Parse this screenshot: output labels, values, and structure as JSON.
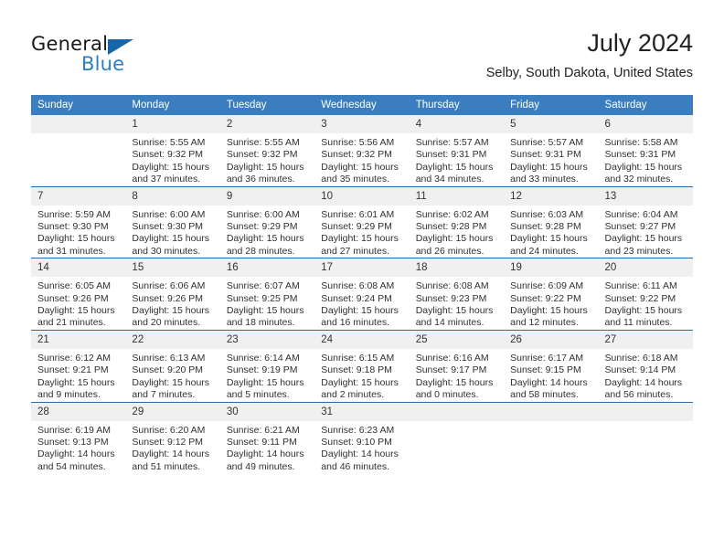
{
  "brand": {
    "name_part1": "General",
    "name_part2": "Blue",
    "accent_color": "#2a7fc9",
    "triangle_color": "#1565a8"
  },
  "header": {
    "title": "July 2024",
    "subtitle": "Selby, South Dakota, United States"
  },
  "theme": {
    "header_bg": "#3a7ebf",
    "row_divider": "#2a6ca8",
    "daynum_bg": "#f0f0f0"
  },
  "weekday_headers": [
    "Sunday",
    "Monday",
    "Tuesday",
    "Wednesday",
    "Thursday",
    "Friday",
    "Saturday"
  ],
  "weeks": [
    [
      {
        "day": "",
        "sunrise": "",
        "sunset": "",
        "daylight_line1": "",
        "daylight_line2": ""
      },
      {
        "day": "1",
        "sunrise": "Sunrise: 5:55 AM",
        "sunset": "Sunset: 9:32 PM",
        "daylight_line1": "Daylight: 15 hours",
        "daylight_line2": "and 37 minutes."
      },
      {
        "day": "2",
        "sunrise": "Sunrise: 5:55 AM",
        "sunset": "Sunset: 9:32 PM",
        "daylight_line1": "Daylight: 15 hours",
        "daylight_line2": "and 36 minutes."
      },
      {
        "day": "3",
        "sunrise": "Sunrise: 5:56 AM",
        "sunset": "Sunset: 9:32 PM",
        "daylight_line1": "Daylight: 15 hours",
        "daylight_line2": "and 35 minutes."
      },
      {
        "day": "4",
        "sunrise": "Sunrise: 5:57 AM",
        "sunset": "Sunset: 9:31 PM",
        "daylight_line1": "Daylight: 15 hours",
        "daylight_line2": "and 34 minutes."
      },
      {
        "day": "5",
        "sunrise": "Sunrise: 5:57 AM",
        "sunset": "Sunset: 9:31 PM",
        "daylight_line1": "Daylight: 15 hours",
        "daylight_line2": "and 33 minutes."
      },
      {
        "day": "6",
        "sunrise": "Sunrise: 5:58 AM",
        "sunset": "Sunset: 9:31 PM",
        "daylight_line1": "Daylight: 15 hours",
        "daylight_line2": "and 32 minutes."
      }
    ],
    [
      {
        "day": "7",
        "sunrise": "Sunrise: 5:59 AM",
        "sunset": "Sunset: 9:30 PM",
        "daylight_line1": "Daylight: 15 hours",
        "daylight_line2": "and 31 minutes."
      },
      {
        "day": "8",
        "sunrise": "Sunrise: 6:00 AM",
        "sunset": "Sunset: 9:30 PM",
        "daylight_line1": "Daylight: 15 hours",
        "daylight_line2": "and 30 minutes."
      },
      {
        "day": "9",
        "sunrise": "Sunrise: 6:00 AM",
        "sunset": "Sunset: 9:29 PM",
        "daylight_line1": "Daylight: 15 hours",
        "daylight_line2": "and 28 minutes."
      },
      {
        "day": "10",
        "sunrise": "Sunrise: 6:01 AM",
        "sunset": "Sunset: 9:29 PM",
        "daylight_line1": "Daylight: 15 hours",
        "daylight_line2": "and 27 minutes."
      },
      {
        "day": "11",
        "sunrise": "Sunrise: 6:02 AM",
        "sunset": "Sunset: 9:28 PM",
        "daylight_line1": "Daylight: 15 hours",
        "daylight_line2": "and 26 minutes."
      },
      {
        "day": "12",
        "sunrise": "Sunrise: 6:03 AM",
        "sunset": "Sunset: 9:28 PM",
        "daylight_line1": "Daylight: 15 hours",
        "daylight_line2": "and 24 minutes."
      },
      {
        "day": "13",
        "sunrise": "Sunrise: 6:04 AM",
        "sunset": "Sunset: 9:27 PM",
        "daylight_line1": "Daylight: 15 hours",
        "daylight_line2": "and 23 minutes."
      }
    ],
    [
      {
        "day": "14",
        "sunrise": "Sunrise: 6:05 AM",
        "sunset": "Sunset: 9:26 PM",
        "daylight_line1": "Daylight: 15 hours",
        "daylight_line2": "and 21 minutes."
      },
      {
        "day": "15",
        "sunrise": "Sunrise: 6:06 AM",
        "sunset": "Sunset: 9:26 PM",
        "daylight_line1": "Daylight: 15 hours",
        "daylight_line2": "and 20 minutes."
      },
      {
        "day": "16",
        "sunrise": "Sunrise: 6:07 AM",
        "sunset": "Sunset: 9:25 PM",
        "daylight_line1": "Daylight: 15 hours",
        "daylight_line2": "and 18 minutes."
      },
      {
        "day": "17",
        "sunrise": "Sunrise: 6:08 AM",
        "sunset": "Sunset: 9:24 PM",
        "daylight_line1": "Daylight: 15 hours",
        "daylight_line2": "and 16 minutes."
      },
      {
        "day": "18",
        "sunrise": "Sunrise: 6:08 AM",
        "sunset": "Sunset: 9:23 PM",
        "daylight_line1": "Daylight: 15 hours",
        "daylight_line2": "and 14 minutes."
      },
      {
        "day": "19",
        "sunrise": "Sunrise: 6:09 AM",
        "sunset": "Sunset: 9:22 PM",
        "daylight_line1": "Daylight: 15 hours",
        "daylight_line2": "and 12 minutes."
      },
      {
        "day": "20",
        "sunrise": "Sunrise: 6:11 AM",
        "sunset": "Sunset: 9:22 PM",
        "daylight_line1": "Daylight: 15 hours",
        "daylight_line2": "and 11 minutes."
      }
    ],
    [
      {
        "day": "21",
        "sunrise": "Sunrise: 6:12 AM",
        "sunset": "Sunset: 9:21 PM",
        "daylight_line1": "Daylight: 15 hours",
        "daylight_line2": "and 9 minutes."
      },
      {
        "day": "22",
        "sunrise": "Sunrise: 6:13 AM",
        "sunset": "Sunset: 9:20 PM",
        "daylight_line1": "Daylight: 15 hours",
        "daylight_line2": "and 7 minutes."
      },
      {
        "day": "23",
        "sunrise": "Sunrise: 6:14 AM",
        "sunset": "Sunset: 9:19 PM",
        "daylight_line1": "Daylight: 15 hours",
        "daylight_line2": "and 5 minutes."
      },
      {
        "day": "24",
        "sunrise": "Sunrise: 6:15 AM",
        "sunset": "Sunset: 9:18 PM",
        "daylight_line1": "Daylight: 15 hours",
        "daylight_line2": "and 2 minutes."
      },
      {
        "day": "25",
        "sunrise": "Sunrise: 6:16 AM",
        "sunset": "Sunset: 9:17 PM",
        "daylight_line1": "Daylight: 15 hours",
        "daylight_line2": "and 0 minutes."
      },
      {
        "day": "26",
        "sunrise": "Sunrise: 6:17 AM",
        "sunset": "Sunset: 9:15 PM",
        "daylight_line1": "Daylight: 14 hours",
        "daylight_line2": "and 58 minutes."
      },
      {
        "day": "27",
        "sunrise": "Sunrise: 6:18 AM",
        "sunset": "Sunset: 9:14 PM",
        "daylight_line1": "Daylight: 14 hours",
        "daylight_line2": "and 56 minutes."
      }
    ],
    [
      {
        "day": "28",
        "sunrise": "Sunrise: 6:19 AM",
        "sunset": "Sunset: 9:13 PM",
        "daylight_line1": "Daylight: 14 hours",
        "daylight_line2": "and 54 minutes."
      },
      {
        "day": "29",
        "sunrise": "Sunrise: 6:20 AM",
        "sunset": "Sunset: 9:12 PM",
        "daylight_line1": "Daylight: 14 hours",
        "daylight_line2": "and 51 minutes."
      },
      {
        "day": "30",
        "sunrise": "Sunrise: 6:21 AM",
        "sunset": "Sunset: 9:11 PM",
        "daylight_line1": "Daylight: 14 hours",
        "daylight_line2": "and 49 minutes."
      },
      {
        "day": "31",
        "sunrise": "Sunrise: 6:23 AM",
        "sunset": "Sunset: 9:10 PM",
        "daylight_line1": "Daylight: 14 hours",
        "daylight_line2": "and 46 minutes."
      },
      {
        "day": "",
        "sunrise": "",
        "sunset": "",
        "daylight_line1": "",
        "daylight_line2": ""
      },
      {
        "day": "",
        "sunrise": "",
        "sunset": "",
        "daylight_line1": "",
        "daylight_line2": ""
      },
      {
        "day": "",
        "sunrise": "",
        "sunset": "",
        "daylight_line1": "",
        "daylight_line2": ""
      }
    ]
  ]
}
